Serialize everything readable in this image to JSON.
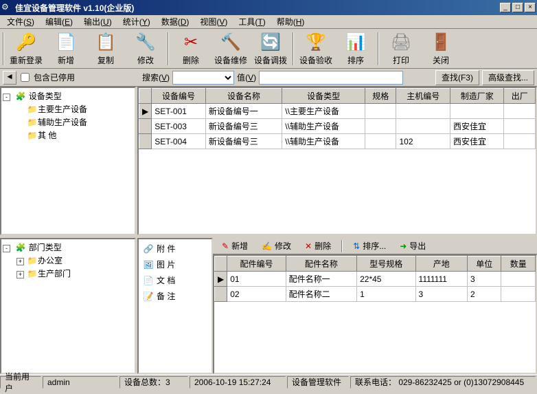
{
  "window": {
    "title": "佳宜设备管理软件  v1.10(企业版)"
  },
  "menu": {
    "items": [
      {
        "label": "文件",
        "accel": "S"
      },
      {
        "label": "编辑",
        "accel": "E"
      },
      {
        "label": "输出",
        "accel": "U"
      },
      {
        "label": "统计",
        "accel": "Y"
      },
      {
        "label": "数据",
        "accel": "D"
      },
      {
        "label": "视图",
        "accel": "V"
      },
      {
        "label": "工具",
        "accel": "T"
      },
      {
        "label": "帮助",
        "accel": "H"
      }
    ]
  },
  "toolbar": {
    "items": [
      {
        "label": "重新登录",
        "icon": "🔑",
        "color": "#c00"
      },
      {
        "label": "新增",
        "icon": "📄",
        "color": "#fc0"
      },
      {
        "label": "复制",
        "icon": "📋",
        "color": "#06c"
      },
      {
        "label": "修改",
        "icon": "🔧",
        "color": "#c60"
      },
      {
        "label": "删除",
        "icon": "✂",
        "color": "#c00"
      },
      {
        "label": "设备维修",
        "icon": "🔨",
        "color": "#888"
      },
      {
        "label": "设备调拨",
        "icon": "🔄",
        "color": "#06c"
      },
      {
        "label": "设备验收",
        "icon": "🏆",
        "color": "#fc0"
      },
      {
        "label": "排序",
        "icon": "📊",
        "color": "#090"
      },
      {
        "label": "打印",
        "icon": "🖨",
        "color": "#888"
      },
      {
        "label": "关闭",
        "icon": "🚪",
        "color": "#c00"
      }
    ]
  },
  "searchbar": {
    "checkbox_label": "包含已停用",
    "search_label": "搜索",
    "value_label": "值",
    "find_btn": "查找(F3)",
    "adv_btn": "高级查找..."
  },
  "tree_top": {
    "root": "设备类型",
    "children": [
      "主要生产设备",
      "辅助生产设备",
      "其     他"
    ]
  },
  "tree_bottom": {
    "root": "部门类型",
    "children": [
      "办公室",
      "生产部门"
    ]
  },
  "main_grid": {
    "headers": [
      "设备编号",
      "设备名称",
      "设备类型",
      "规格",
      "主机编号",
      "制造厂家",
      "出厂"
    ],
    "rows": [
      {
        "no": "SET-001",
        "name": "新设备编号一",
        "type": "\\\\主要生产设备",
        "spec": "",
        "host": "",
        "mfr": "",
        "out": ""
      },
      {
        "no": "SET-003",
        "name": "新设备编号三",
        "type": "\\\\辅助生产设备",
        "spec": "",
        "host": "",
        "mfr": "西安佳宜",
        "out": ""
      },
      {
        "no": "SET-004",
        "name": "新设备编号三",
        "type": "\\\\辅助生产设备",
        "spec": "",
        "host": "102",
        "mfr": "西安佳宜",
        "out": ""
      }
    ]
  },
  "tabs": {
    "items": [
      {
        "label": "附     件",
        "icon": "🔗",
        "color": "#c00"
      },
      {
        "label": "图     片",
        "icon": "🖼",
        "color": "#06c"
      },
      {
        "label": "文     档",
        "icon": "📄",
        "color": "#090"
      },
      {
        "label": "备     注",
        "icon": "📝",
        "color": "#888"
      }
    ]
  },
  "minibar": {
    "add": "新增",
    "edit": "修改",
    "del": "删除",
    "sort": "排序...",
    "export": "导出"
  },
  "detail_grid": {
    "headers": [
      "配件编号",
      "配件名称",
      "型号规格",
      "产地",
      "单位",
      "数量"
    ],
    "rows": [
      {
        "no": "01",
        "name": "配件名称一",
        "model": "22*45",
        "origin": "1111111",
        "unit": "3",
        "qty": ""
      },
      {
        "no": "02",
        "name": "配件名称二",
        "model": "1",
        "origin": "3",
        "unit": "2",
        "qty": ""
      }
    ]
  },
  "status": {
    "user_lbl": "当前用户",
    "user_val": "admin",
    "count": "设备总数：3",
    "time": "2006-10-19 15:27:24",
    "app": "设备管理软件",
    "contact": "联系电话： 029-86232425 or (0)13072908445"
  }
}
